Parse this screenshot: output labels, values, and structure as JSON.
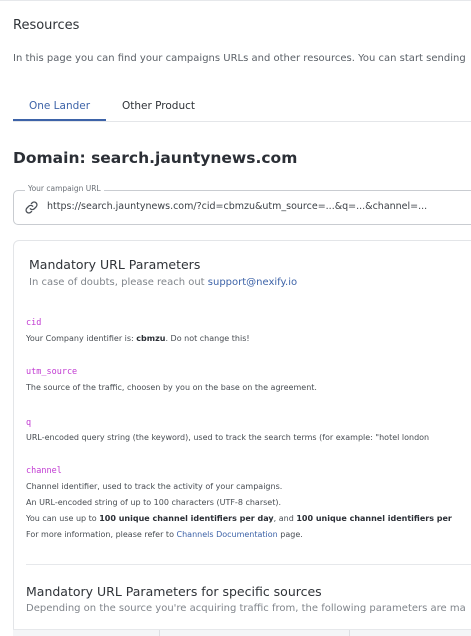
{
  "page": {
    "title": "Resources",
    "intro": "In this page you can find your campaigns URLs and other resources. You can start sending"
  },
  "tabs": [
    {
      "label": "One Lander",
      "active": true
    },
    {
      "label": "Other Product",
      "active": false
    }
  ],
  "domain": {
    "heading": "Domain: search.jauntynews.com"
  },
  "campaign_url": {
    "label": "Your campaign URL",
    "value": "https://search.jauntynews.com/?cid=cbmzu&utm_source=...&q=...&channel=...",
    "icon": "link-icon"
  },
  "mandatory": {
    "title": "Mandatory URL Parameters",
    "subtitle_prefix": "In case of doubts, please reach out ",
    "support_email": "support@nexify.io",
    "params": [
      {
        "name": "cid",
        "lines": [
          {
            "pre": "Your Company identifier is: ",
            "bold": "cbmzu",
            "post": ". Do not change this!"
          }
        ]
      },
      {
        "name": "utm_source",
        "lines": [
          {
            "pre": "The source of the traffic, choosen by you on the base on the agreement.",
            "bold": "",
            "post": ""
          }
        ]
      },
      {
        "name": "q",
        "lines": [
          {
            "pre": "URL-encoded query string (the keyword), used to track the search terms (for example: \"hotel london",
            "bold": "",
            "post": ""
          }
        ]
      },
      {
        "name": "channel",
        "lines": [
          {
            "pre": "Channel identifier, used to track the activity of your campaigns."
          },
          {
            "pre": "An URL-encoded string of up to 100 characters (UTF-8 charset)."
          },
          {
            "pre": "You can use up to ",
            "bold": "100 unique channel identifiers per day",
            "mid": ", and ",
            "bold2": "100 unique channel identifiers per"
          },
          {
            "pre": "For more information, please refer to ",
            "link": "Channels Documentation",
            "post": " page."
          }
        ]
      }
    ]
  },
  "specific": {
    "title": "Mandatory URL Parameters for specific sources",
    "subtitle": "Depending on the source you're acquiring traffic from, the following parameters are ma"
  },
  "colors": {
    "accent": "#3d63a8",
    "param": "#c13bd2",
    "border": "#e3e5e8"
  }
}
